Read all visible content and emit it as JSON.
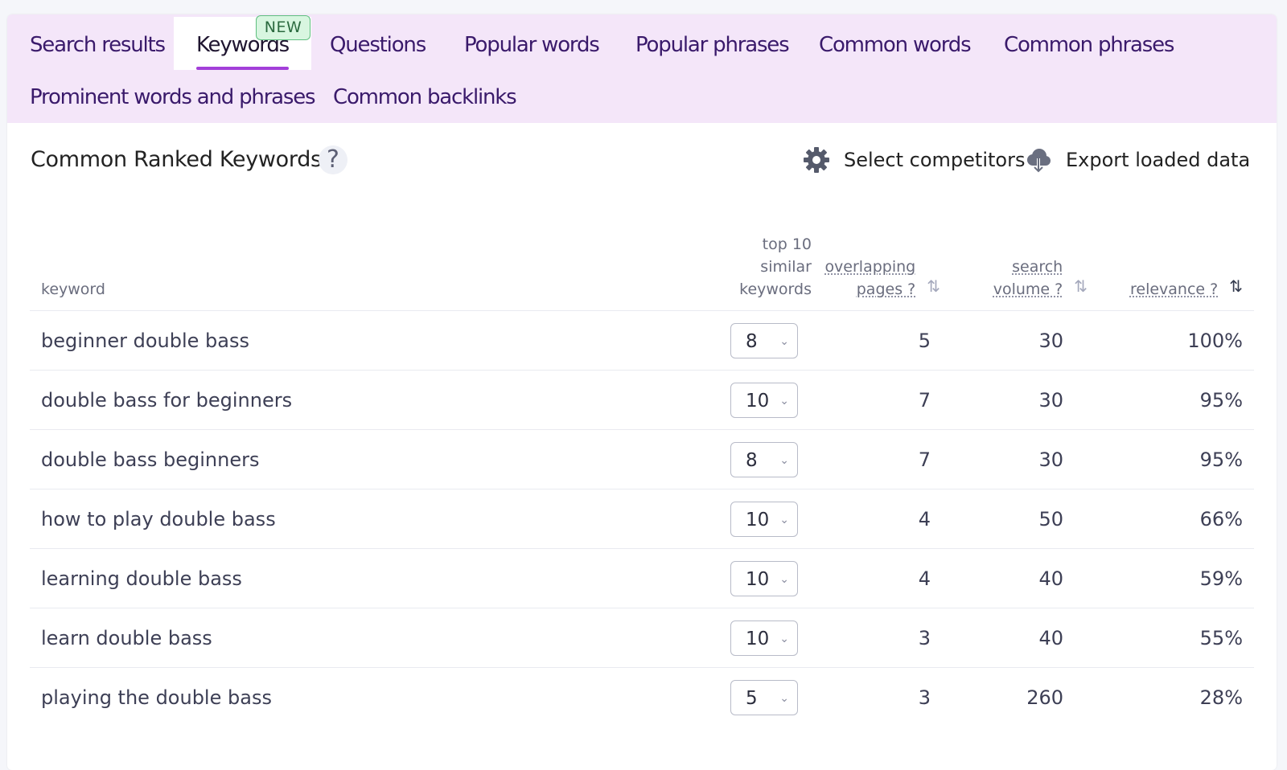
{
  "tabs": [
    {
      "label": "Search results"
    },
    {
      "label": "Keywords",
      "badge": "NEW",
      "active": true
    },
    {
      "label": "Questions"
    },
    {
      "label": "Popular words"
    },
    {
      "label": "Popular phrases"
    },
    {
      "label": "Common words"
    },
    {
      "label": "Common phrases"
    },
    {
      "label": "Prominent words and phrases"
    },
    {
      "label": "Common backlinks"
    }
  ],
  "section": {
    "title": "Common Ranked Keywords",
    "help": "?",
    "select_competitors": "Select competitors",
    "export": "Export loaded data"
  },
  "table": {
    "columns": {
      "keyword": "keyword",
      "similar_1": "top 10",
      "similar_2": "similar",
      "similar_3": "keywords",
      "overlapping_1": "overlapping",
      "overlapping_2": "pages ?",
      "search_1": "search",
      "search_2": "volume ?",
      "relevance": "relevance ?"
    },
    "rows": [
      {
        "keyword": "beginner double bass",
        "similar": "8",
        "overlapping": "5",
        "volume": "30",
        "relevance": "100%"
      },
      {
        "keyword": "double bass for beginners",
        "similar": "10",
        "overlapping": "7",
        "volume": "30",
        "relevance": "95%"
      },
      {
        "keyword": "double bass beginners",
        "similar": "8",
        "overlapping": "7",
        "volume": "30",
        "relevance": "95%"
      },
      {
        "keyword": "how to play double bass",
        "similar": "10",
        "overlapping": "4",
        "volume": "50",
        "relevance": "66%"
      },
      {
        "keyword": "learning double bass",
        "similar": "10",
        "overlapping": "4",
        "volume": "40",
        "relevance": "59%"
      },
      {
        "keyword": "learn double bass",
        "similar": "10",
        "overlapping": "3",
        "volume": "40",
        "relevance": "55%"
      },
      {
        "keyword": "playing the double bass",
        "similar": "5",
        "overlapping": "3",
        "volume": "260",
        "relevance": "28%"
      }
    ]
  },
  "colors": {
    "tab_bg": "#f4e6f9",
    "accent": "#a33fd9",
    "badge_bg": "#d8f6e0"
  },
  "icons": {
    "settings": "gear-icon",
    "export": "cloud-download-icon",
    "sort": "sort-arrows-icon",
    "chevron": "chevron-down-icon"
  }
}
